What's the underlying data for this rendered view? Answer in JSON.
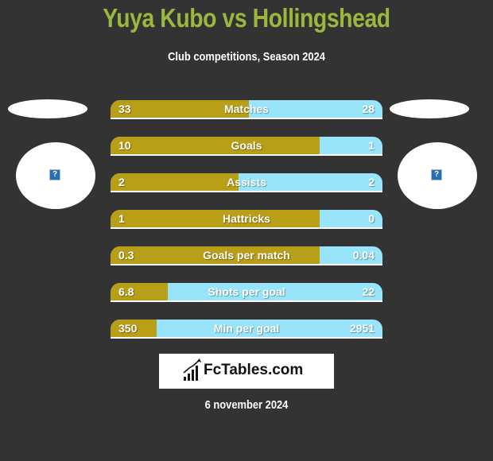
{
  "header": {
    "title": "Yuya Kubo vs Hollingshead",
    "subtitle": "Club competitions, Season 2024"
  },
  "players": {
    "left": {
      "image_icon": "broken-image-icon",
      "icon_glyph": "?"
    },
    "right": {
      "image_icon": "broken-image-icon",
      "icon_glyph": "?"
    }
  },
  "colors": {
    "title": "#9ab83e",
    "left_fill": "#b99e18",
    "right_fill": "#97e4fb",
    "background": "#333333"
  },
  "stats": [
    {
      "label": "Matches",
      "left": "33",
      "right": "28",
      "left_share": 0.51
    },
    {
      "label": "Goals",
      "left": "10",
      "right": "1",
      "left_share": 0.77
    },
    {
      "label": "Assists",
      "left": "2",
      "right": "2",
      "left_share": 0.47
    },
    {
      "label": "Hattricks",
      "left": "1",
      "right": "0",
      "left_share": 0.77
    },
    {
      "label": "Goals per match",
      "left": "0.3",
      "right": "0.04",
      "left_share": 0.77
    },
    {
      "label": "Shots per goal",
      "left": "6.8",
      "right": "22",
      "left_share": 0.21
    },
    {
      "label": "Min per goal",
      "left": "350",
      "right": "2951",
      "left_share": 0.17
    }
  ],
  "logo": {
    "text": "FcTables.com",
    "icon": "bar-chart-trend-icon"
  },
  "footer": {
    "date": "6 november 2024"
  }
}
